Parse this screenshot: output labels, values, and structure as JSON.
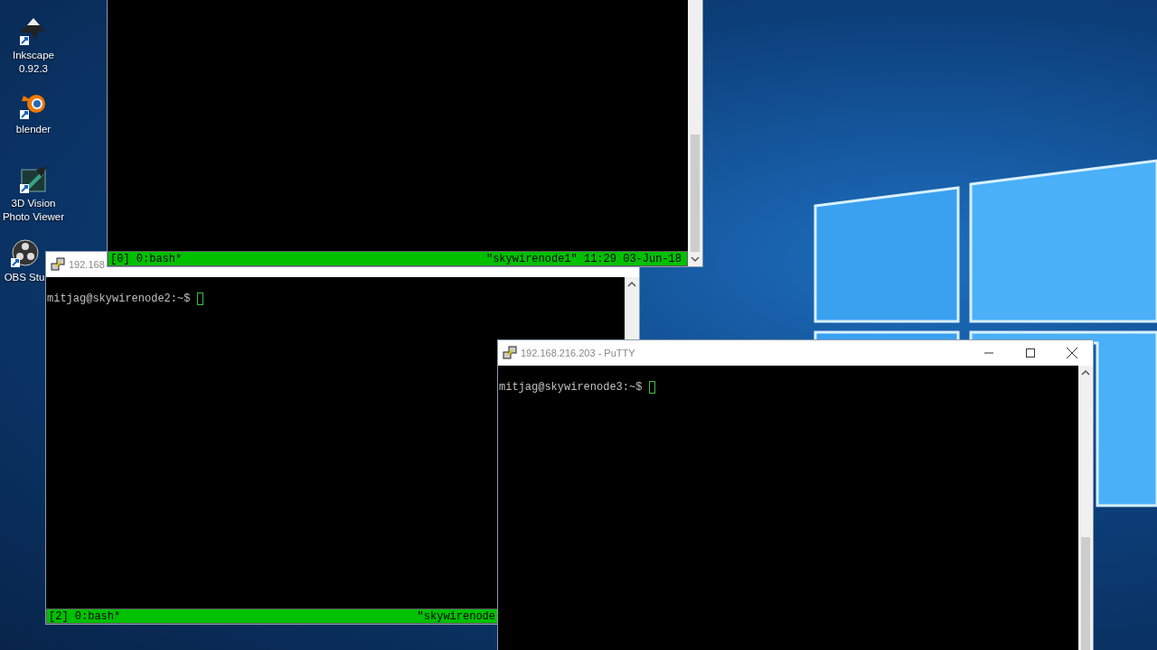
{
  "desktop_icons": [
    {
      "kind": "inkscape",
      "label": "Inkscape 0.92.3"
    },
    {
      "kind": "blender",
      "label": "blender"
    },
    {
      "kind": "viewer",
      "label": "3D Vision Photo Viewer"
    },
    {
      "kind": "obs",
      "label": "OBS Stu"
    }
  ],
  "windows": [
    {
      "title": "192.168",
      "prompt": "mitjag@skywirenode2:~$",
      "status_bar": {
        "left": "[2] 0:bash*",
        "right": "\"skywirenode"
      }
    },
    {
      "status_bar": {
        "left": "[0] 0:bash*",
        "right": "\"skywirenode1\" 11:29 03-Jun-18"
      }
    },
    {
      "title": "192.168.216.203 - PuTTY",
      "caption_buttons": true,
      "prompt": "mitjag@skywirenode3:~$"
    }
  ]
}
